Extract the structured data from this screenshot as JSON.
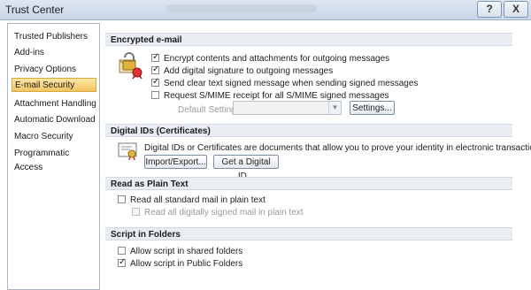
{
  "window": {
    "title": "Trust Center",
    "help_label": "?",
    "close_label": "X"
  },
  "sidebar": {
    "items": [
      {
        "label": "Trusted Publishers",
        "selected": false
      },
      {
        "label": "Add-ins",
        "selected": false
      },
      {
        "label": "Privacy Options",
        "selected": false
      },
      {
        "label": "E-mail Security",
        "selected": true
      },
      {
        "label": "Attachment Handling",
        "selected": false
      },
      {
        "label": "Automatic Download",
        "selected": false
      },
      {
        "label": "Macro Security",
        "selected": false
      },
      {
        "label": "Programmatic Access",
        "selected": false
      }
    ]
  },
  "encrypted": {
    "title": "Encrypted e-mail",
    "options": [
      {
        "label": "Encrypt contents and attachments for outgoing messages",
        "checked": true
      },
      {
        "label": "Add digital signature to outgoing messages",
        "checked": true
      },
      {
        "label": "Send clear text signed message when sending signed messages",
        "checked": true
      },
      {
        "label": "Request S/MIME receipt for all S/MIME signed messages",
        "checked": false
      }
    ],
    "default_setting_label": "Default Setting:",
    "default_setting_value": "",
    "settings_button": "Settings..."
  },
  "digital_ids": {
    "title": "Digital IDs (Certificates)",
    "description": "Digital IDs or Certificates are documents that allow you to prove your identity in electronic transactions.",
    "import_button": "Import/Export...",
    "get_button": "Get a Digital ID..."
  },
  "plain_text": {
    "title": "Read as Plain Text",
    "options": [
      {
        "label": "Read all standard mail in plain text",
        "checked": false,
        "enabled": true
      },
      {
        "label": "Read all digitally signed mail in plain text",
        "checked": false,
        "enabled": false
      }
    ]
  },
  "scripts": {
    "title": "Script in Folders",
    "options": [
      {
        "label": "Allow script in shared folders",
        "checked": false
      },
      {
        "label": "Allow script in Public Folders",
        "checked": true
      }
    ]
  },
  "colors": {
    "selected_nav": "#f6c965",
    "section_header": "#e9edf2",
    "titlebar": "#d3deec"
  }
}
